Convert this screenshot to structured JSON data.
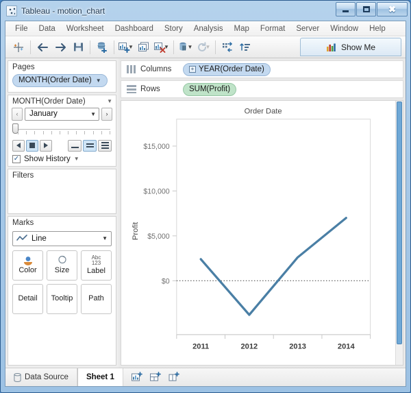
{
  "window": {
    "title": "Tableau - motion_chart",
    "app_icon": "tableau-icon",
    "controls": {
      "minimize": "Minimize",
      "maximize": "Maximize",
      "close": "Close"
    }
  },
  "menubar": {
    "items": [
      "File",
      "Data",
      "Worksheet",
      "Dashboard",
      "Story",
      "Analysis",
      "Map",
      "Format",
      "Server",
      "Window",
      "Help"
    ]
  },
  "toolbar": {
    "buttons": [
      {
        "name": "tableau-logo-button",
        "tooltip": "Tableau Start Page"
      },
      {
        "name": "back-button",
        "tooltip": "Back"
      },
      {
        "name": "forward-button",
        "tooltip": "Forward"
      },
      {
        "name": "save-button",
        "tooltip": "Save"
      },
      {
        "name": "new-data-source-button",
        "tooltip": "Connect to Data"
      },
      {
        "name": "new-worksheet-button",
        "tooltip": "New Worksheet"
      },
      {
        "name": "duplicate-sheet-button",
        "tooltip": "Duplicate Sheet"
      },
      {
        "name": "clear-sheet-button",
        "tooltip": "Clear Sheet"
      },
      {
        "name": "pause-updates-button",
        "tooltip": "Pause Auto Updates"
      },
      {
        "name": "refresh-button",
        "tooltip": "Run Update"
      },
      {
        "name": "swap-rows-columns-button",
        "tooltip": "Swap Rows and Columns"
      },
      {
        "name": "sort-ascending-button",
        "tooltip": "Sort Ascending"
      }
    ],
    "show_me_label": "Show Me"
  },
  "pages_card": {
    "title": "Pages",
    "pill": "MONTH(Order Date)"
  },
  "page_control_card": {
    "title": "MONTH(Order Date)",
    "prev_label": "‹",
    "next_label": "›",
    "current_value": "January",
    "show_history_label": "Show History",
    "show_history_checked": true,
    "check_glyph": "✓",
    "tick_count": 12,
    "speed_buttons": [
      "slow",
      "medium",
      "fast"
    ],
    "speed_selected": 1,
    "transport": [
      "step-back",
      "stop",
      "step-forward"
    ],
    "transport_selected": 1
  },
  "filters_card": {
    "title": "Filters",
    "items": []
  },
  "marks_card": {
    "title": "Marks",
    "mark_type": "Line",
    "buttons": [
      {
        "name": "color",
        "label": "Color"
      },
      {
        "name": "size",
        "label": "Size"
      },
      {
        "name": "label",
        "label": "Label",
        "sublabel_top": "Abc",
        "sublabel_bottom": "123"
      },
      {
        "name": "detail",
        "label": "Detail"
      },
      {
        "name": "tooltip",
        "label": "Tooltip"
      },
      {
        "name": "path",
        "label": "Path"
      }
    ]
  },
  "shelves": {
    "columns": {
      "label": "Columns",
      "pill": "YEAR(Order Date)",
      "expander": "+"
    },
    "rows": {
      "label": "Rows",
      "pill": "SUM(Profit)"
    }
  },
  "statusbar": {
    "data_source_label": "Data Source",
    "sheet_label": "Sheet 1",
    "icons": [
      "new-worksheet-icon",
      "new-dashboard-icon",
      "new-story-icon"
    ]
  },
  "colors": {
    "line": "#4a7fa5",
    "pill_blue": "#c3d9f0",
    "pill_green": "#bfe3c8",
    "accent": "#2e6da4"
  },
  "chart_data": {
    "type": "line",
    "title": "Order Date",
    "xlabel": "",
    "ylabel": "Profit",
    "categories": [
      "2011",
      "2012",
      "2013",
      "2014"
    ],
    "series": [
      {
        "name": "SUM(Profit)",
        "values": [
          2400,
          -3800,
          2600,
          7000
        ]
      }
    ],
    "ytick_labels": [
      "$15,000",
      "$10,000",
      "$5,000",
      "$0"
    ],
    "ytick_values": [
      15000,
      10000,
      5000,
      0
    ],
    "ylim": [
      -6000,
      18000
    ],
    "zero_line": 0,
    "grid": false,
    "legend": "none"
  }
}
